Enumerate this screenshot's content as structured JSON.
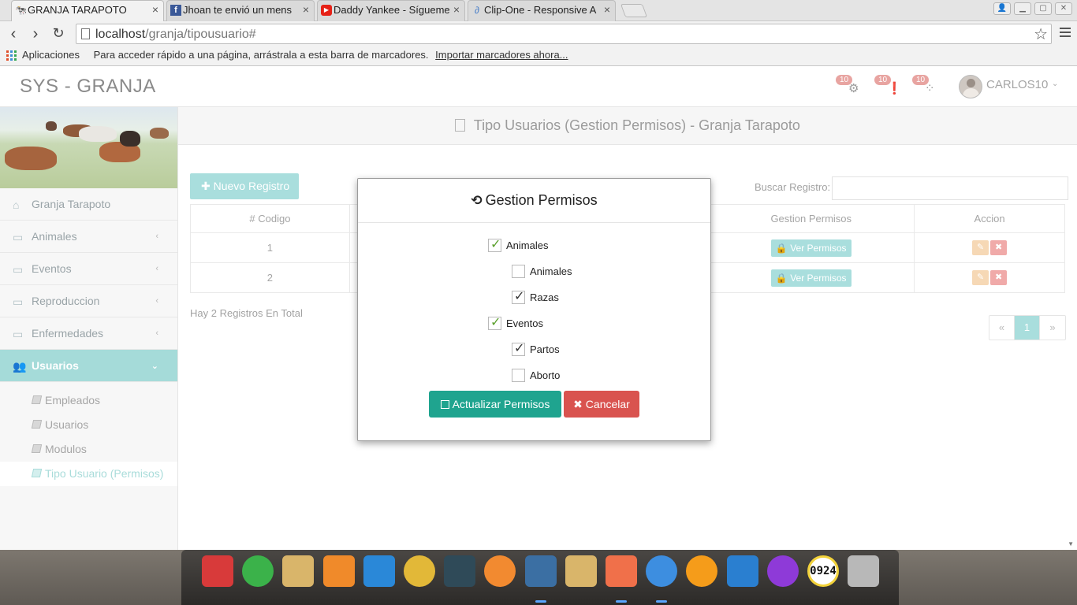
{
  "browser": {
    "tabs": [
      {
        "title": "GRANJA TARAPOTO",
        "favicon": "granja-icon",
        "active": true
      },
      {
        "title": "Jhoan te envió un mens",
        "favicon": "facebook-icon",
        "active": false
      },
      {
        "title": "Daddy Yankee - Sígueme",
        "favicon": "youtube-icon",
        "active": false
      },
      {
        "title": "Clip-One - Responsive A",
        "favicon": "link-icon",
        "active": false
      }
    ],
    "close_glyph": "×",
    "url_host": "localhost",
    "url_path": "/granja/tipousuario#",
    "bookmarks": {
      "apps_label": "Aplicaciones",
      "hint": "Para acceder rápido a una página, arrástrala a esta barra de marcadores.",
      "import_link": "Importar marcadores ahora..."
    }
  },
  "header": {
    "brand": "SYS - GRANJA",
    "notifications": [
      {
        "icon": "gear-icon",
        "count": "10"
      },
      {
        "icon": "alert-icon",
        "count": "10"
      },
      {
        "icon": "spinner-icon",
        "count": "10"
      }
    ],
    "user_name": "CARLOS10"
  },
  "sidebar": {
    "items": [
      {
        "label": "Granja Tarapoto",
        "icon": "home-icon"
      },
      {
        "label": "Animales",
        "icon": "desktop-icon"
      },
      {
        "label": "Eventos",
        "icon": "desktop-icon"
      },
      {
        "label": "Reproduccion",
        "icon": "desktop-icon"
      },
      {
        "label": "Enfermedades",
        "icon": "desktop-icon"
      },
      {
        "label": "Usuarios",
        "icon": "users-icon",
        "active": true
      }
    ],
    "subitems": [
      {
        "label": "Empleados"
      },
      {
        "label": "Usuarios"
      },
      {
        "label": "Modulos"
      },
      {
        "label": "Tipo Usuario (Permisos)",
        "current": true
      }
    ]
  },
  "main": {
    "page_title": "Tipo Usuarios (Gestion Permisos) - Granja Tarapoto",
    "new_button": "Nuevo Registro",
    "search_label": "Buscar Registro:",
    "columns": [
      "# Codigo",
      "",
      "Gestion Permisos",
      "Accion"
    ],
    "rows": [
      {
        "codigo": "1",
        "perm_button": "Ver Permisos"
      },
      {
        "codigo": "2",
        "perm_button": "Ver Permisos"
      }
    ],
    "total_text": "Hay 2 Registros En Total",
    "pager": {
      "prev": "«",
      "current": "1",
      "next": "»"
    }
  },
  "modal": {
    "title": "Gestion Permisos",
    "permissions": [
      {
        "label": "Animales",
        "checked": true,
        "level": 0
      },
      {
        "label": "Animales",
        "checked": false,
        "level": 1
      },
      {
        "label": "Razas",
        "checked": true,
        "level": 1
      },
      {
        "label": "Eventos",
        "checked": true,
        "level": 0
      },
      {
        "label": "Partos",
        "checked": true,
        "level": 1
      },
      {
        "label": "Aborto",
        "checked": false,
        "level": 1
      }
    ],
    "update_button": "Actualizar Permisos",
    "cancel_button": "Cancelar"
  },
  "dock": {
    "icons": [
      {
        "name": "rocket-launcher-icon",
        "color": "#d83a3a"
      },
      {
        "name": "mail-app-icon",
        "color": "#3bb24a"
      },
      {
        "name": "folder-icon",
        "color": "#d9b56a"
      },
      {
        "name": "store-bag-icon",
        "color": "#f08a2a"
      },
      {
        "name": "video-player-icon",
        "color": "#2a88d8"
      },
      {
        "name": "chrome-icon",
        "color": "#e2b838"
      },
      {
        "name": "toggle-app-icon",
        "color": "#2f4a58"
      },
      {
        "name": "sublime-icon",
        "color": "#f28a30"
      },
      {
        "name": "postgresql-icon",
        "color": "#3b6fa3"
      },
      {
        "name": "folder-icon",
        "color": "#d9b56a"
      },
      {
        "name": "battery-icon",
        "color": "#f0704a"
      },
      {
        "name": "network-globe-icon",
        "color": "#3d8ee0"
      },
      {
        "name": "ring-app-icon",
        "color": "#f59c1a"
      },
      {
        "name": "crossover-icon",
        "color": "#2a7fd0"
      },
      {
        "name": "power-icon",
        "color": "#8e3ad8"
      },
      {
        "name": "clock-icon",
        "color": "#f2d23a"
      },
      {
        "name": "trash-icon",
        "color": "#b8b8b8"
      }
    ],
    "clock_text": "0924"
  }
}
